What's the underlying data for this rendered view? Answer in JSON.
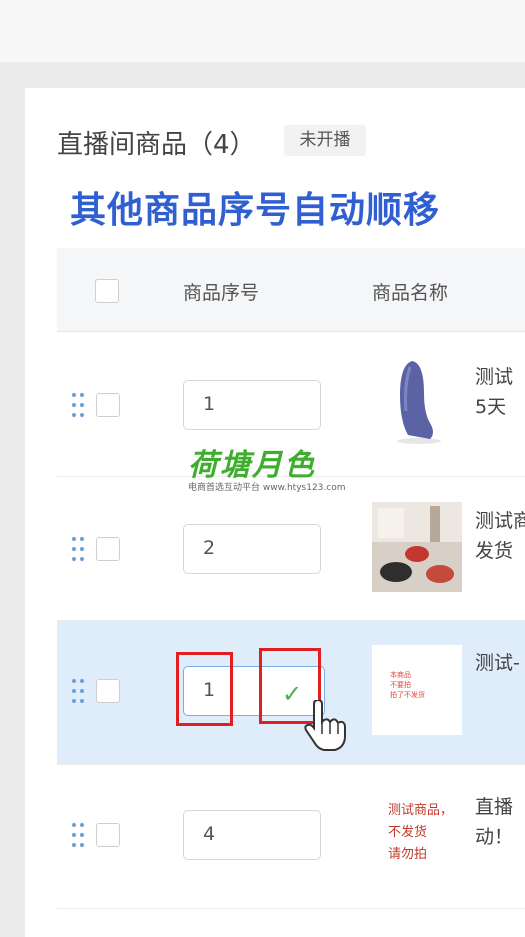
{
  "page_title": "直播间商品（4）",
  "status_badge": "未开播",
  "overlay_caption": "其他商品序号自动顺移",
  "table": {
    "headers": [
      "商品序号",
      "商品名称"
    ]
  },
  "rows": [
    {
      "seq": "1",
      "name_lines": [
        "测试",
        "5天"
      ]
    },
    {
      "seq": "2",
      "name_lines": [
        "测试商",
        "发货"
      ]
    },
    {
      "seq": "1",
      "name_lines": [
        "测试-"
      ]
    },
    {
      "seq": "4",
      "name_lines": [
        "直播",
        "动！"
      ]
    }
  ],
  "thumb_text": {
    "row3": [
      "本商品",
      "不要拍",
      "拍了不发货"
    ],
    "row4": [
      "测试商品，",
      "不发货",
      "请勿拍"
    ]
  },
  "confirm_icon": "✓",
  "watermark": {
    "main": "荷塘月色",
    "sub": "电商首选互动平台 www.htys123.com"
  },
  "colors": {
    "accent": "#2f5fd0",
    "highlight_row": "#deedf9",
    "red_box": "#e02020",
    "check": "#4caf50"
  }
}
